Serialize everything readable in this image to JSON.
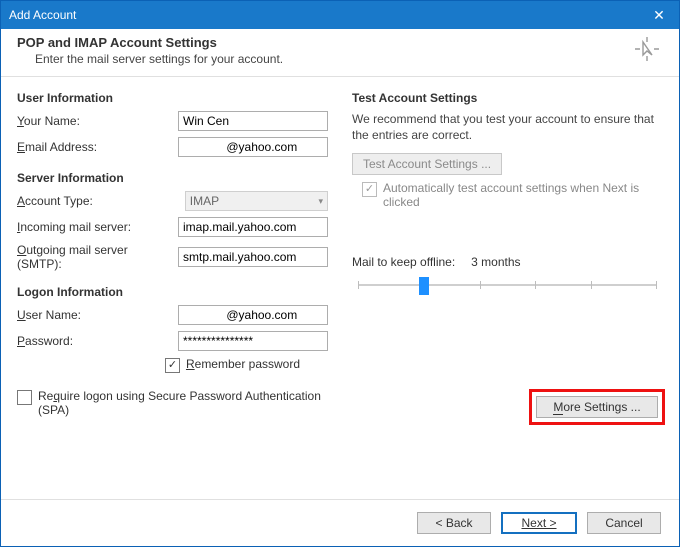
{
  "window": {
    "title": "Add Account",
    "close_glyph": "✕"
  },
  "header": {
    "title": "POP and IMAP Account Settings",
    "subtitle": "Enter the mail server settings for your account."
  },
  "left": {
    "user_info_heading": "User Information",
    "your_name_label": "our Name:",
    "your_name_value": "Win Cen",
    "email_label": "mail Address:",
    "email_value": "             @yahoo.com",
    "server_info_heading": "Server Information",
    "account_type_label": "ccount Type:",
    "account_type_value": "IMAP",
    "incoming_label": "ncoming mail server:",
    "incoming_value": "imap.mail.yahoo.com",
    "outgoing_label": "utgoing mail server (SMTP):",
    "outgoing_value": "smtp.mail.yahoo.com",
    "logon_heading": "Logon Information",
    "user_name_label": "ser Name:",
    "user_name_value": "             @yahoo.com",
    "password_label": "assword:",
    "password_value": "***************",
    "remember_label": "emember password",
    "spa_label": "uire logon using Secure Password Authentication (SPA)"
  },
  "right": {
    "test_heading": "Test Account Settings",
    "test_desc": "We recommend that you test your account to ensure that the entries are correct.",
    "test_button": "Test Account Settings ...",
    "auto_test_label": "Automatically test account settings when Next is clicked",
    "slider_title": "Mail to keep offline:",
    "slider_value": "3 months",
    "more_settings_label": "ore Settings ..."
  },
  "footer": {
    "back": "< Back",
    "next": "Next >",
    "cancel": "Cancel"
  }
}
